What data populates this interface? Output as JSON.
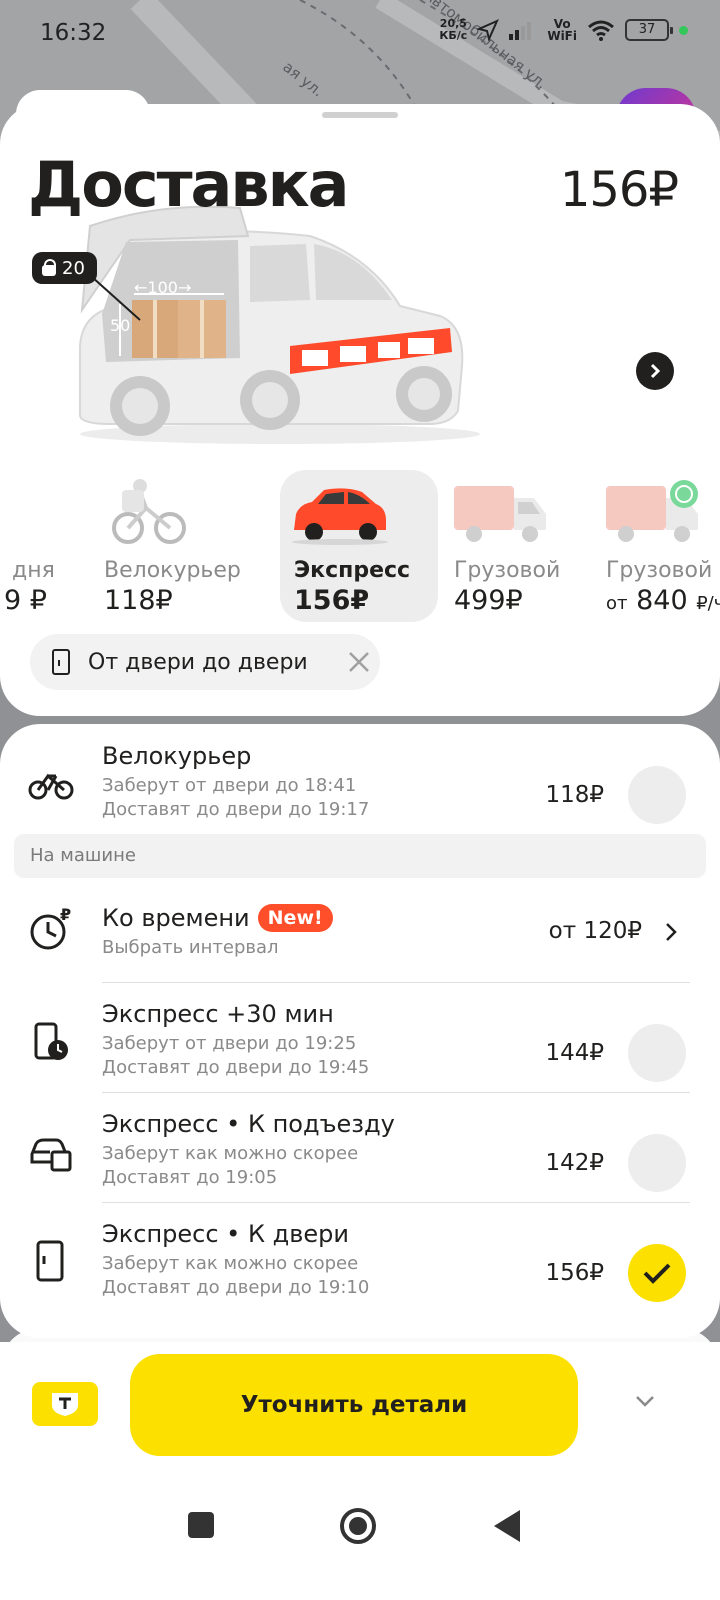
{
  "status_bar": {
    "time": "16:32",
    "speed_value": "20,5",
    "speed_unit": "КБ/с",
    "vowifi_top": "Vo",
    "vowifi_bottom": "WiFi",
    "battery": "37"
  },
  "map": {
    "street1": "ая ул.",
    "street2": "Автомобильная ул."
  },
  "header": {
    "title": "Доставка",
    "price": "156₽",
    "weight": "20",
    "dim_width": "←100→",
    "dim_height": "50"
  },
  "tariffs": [
    {
      "name": "дня",
      "price": "9 ₽",
      "selected": false
    },
    {
      "name": "Велокурьер",
      "price": "118₽",
      "selected": false
    },
    {
      "name": "Экспресс",
      "price": "156₽",
      "selected": true
    },
    {
      "name": "Грузовой",
      "price": "499₽",
      "selected": false
    },
    {
      "name": "Грузовой",
      "price_prefix": "от",
      "price": "840",
      "price_suffix": "₽/ч",
      "selected": false
    }
  ],
  "chip": {
    "label": "От двери до двери"
  },
  "options": {
    "bike": {
      "title": "Велокурьер",
      "line1": "Заберут от двери до 18:41",
      "line2": "Доставят до двери до 19:17",
      "price": "118₽"
    },
    "section_car": "На машине",
    "timed": {
      "title": "Ко времени",
      "badge": "New!",
      "line1": "Выбрать интервал",
      "price": "от 120₽"
    },
    "express30": {
      "title": "Экспресс +30 мин",
      "line1": "Заберут от двери до 19:25",
      "line2": "Доставят до двери до 19:45",
      "price": "144₽"
    },
    "entrance": {
      "title": "Экспресс • К подъезду",
      "line1": "Заберут как можно скорее",
      "line2": "Доставят до 19:05",
      "price": "142₽"
    },
    "door": {
      "title": "Экспресс • К двери",
      "line1": "Заберут как можно скорее",
      "line2": "Доставят до двери до 19:10",
      "price": "156₽",
      "selected": true
    }
  },
  "bottom": {
    "cta": "Уточнить детали"
  },
  "colors": {
    "accent": "#fce000",
    "new_badge": "#ff4e2a",
    "text": "#21201f"
  }
}
